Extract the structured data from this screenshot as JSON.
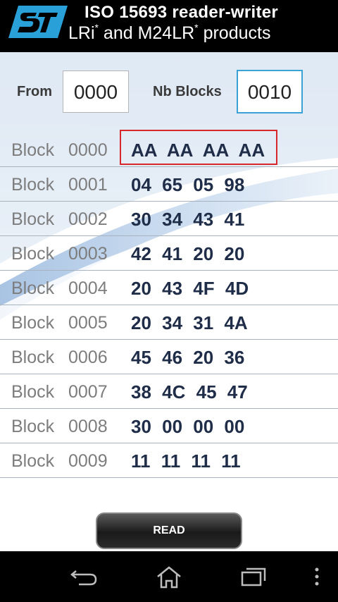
{
  "header": {
    "title_line1": "ISO 15693 reader-writer",
    "title_line2_a": "LRi",
    "title_line2_b": " and M24LR",
    "title_line2_c": " products",
    "asterisk": "*"
  },
  "form": {
    "from_label": "From",
    "from_value": "0000",
    "nb_blocks_label": "Nb Blocks",
    "nb_blocks_value": "0010"
  },
  "blocks": [
    {
      "label": "Block",
      "num": "0000",
      "data": "AA AA AA AA"
    },
    {
      "label": "Block",
      "num": "0001",
      "data": "04 65 05 98"
    },
    {
      "label": "Block",
      "num": "0002",
      "data": "30 34 43 41"
    },
    {
      "label": "Block",
      "num": "0003",
      "data": "42 41 20 20"
    },
    {
      "label": "Block",
      "num": "0004",
      "data": "20 43 4F 4D"
    },
    {
      "label": "Block",
      "num": "0005",
      "data": "20 34 31 4A"
    },
    {
      "label": "Block",
      "num": "0006",
      "data": "45 46 20 36"
    },
    {
      "label": "Block",
      "num": "0007",
      "data": "38 4C 45 47"
    },
    {
      "label": "Block",
      "num": "0008",
      "data": "30 00 00 00"
    },
    {
      "label": "Block",
      "num": "0009",
      "data": "11 11 11 11"
    }
  ],
  "read_button": "READ",
  "nav": {
    "icons": [
      "back-icon",
      "home-icon",
      "recent-apps-icon",
      "overflow-menu-icon"
    ]
  },
  "colors": {
    "header_bg": "#000000",
    "logo_blue": "#2aa0d8",
    "data_text": "#1f2d48",
    "highlight": "#d9262b",
    "focus": "#3ba2d6"
  }
}
